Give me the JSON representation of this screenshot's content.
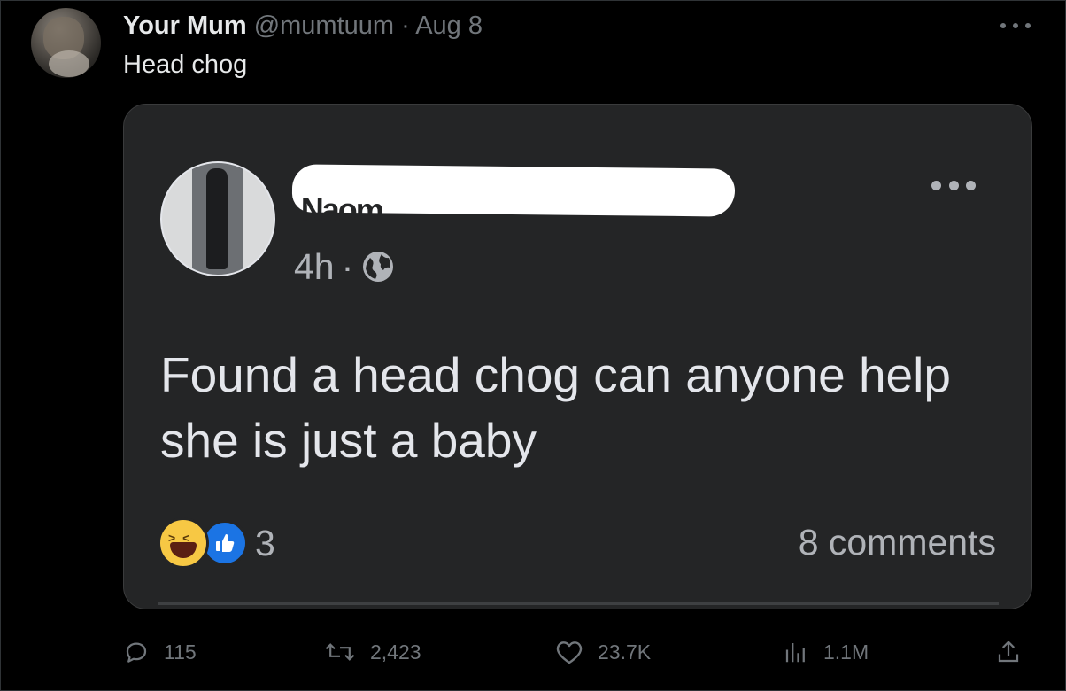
{
  "tweet": {
    "author_name": "Your Mum",
    "handle_date": "@mumtuum · Aug 8",
    "text": "Head chog",
    "more_icon": "ellipsis-icon"
  },
  "quoted_post": {
    "name_redacted": "Naom",
    "time": "4h",
    "separator": "·",
    "visibility_icon": "globe-icon",
    "body": "Found a head chog can anyone help she is just a baby",
    "reaction_count": "3",
    "comments": "8 comments",
    "reactions": [
      "haha-reaction-icon",
      "like-reaction-icon"
    ]
  },
  "actions": {
    "replies": "115",
    "retweets": "2,423",
    "likes": "23.7K",
    "views": "1.1M"
  },
  "colors": {
    "background": "#000000",
    "card": "#242526",
    "muted": "#71767b",
    "like_blue": "#1b74e4",
    "haha_yellow": "#f7c844"
  }
}
